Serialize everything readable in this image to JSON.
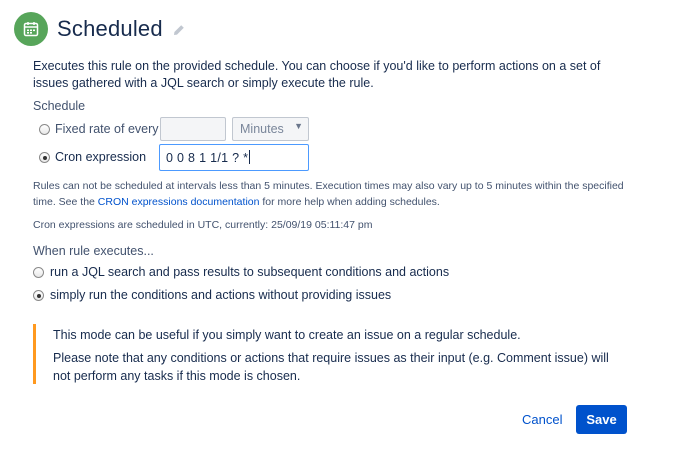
{
  "header": {
    "icon": "calendar-icon",
    "title": "Scheduled",
    "edit_icon": "pencil-icon"
  },
  "description": "Executes this rule on the provided schedule. You can choose if you'd like to perform actions on a set of issues gathered with a JQL search or simply execute the rule.",
  "schedule": {
    "label": "Schedule",
    "fixed_rate": {
      "label": "Fixed rate of every",
      "selected": false,
      "value": "",
      "unit": "Minutes"
    },
    "cron": {
      "label": "Cron expression",
      "selected": true,
      "value": "0 0 8 1 1/1 ? *"
    }
  },
  "help": {
    "text_before_link": "Rules can not be scheduled at intervals less than 5 minutes. Execution times may also vary up to 5 minutes within the specified time. See the ",
    "link_text": "CRON expressions documentation",
    "text_after_link": " for more help when adding schedules.",
    "utc_note": "Cron expressions are scheduled in UTC, currently: 25/09/19 05:11:47 pm"
  },
  "execution": {
    "label": "When rule executes...",
    "options": [
      {
        "label": "run a JQL search and pass results to subsequent conditions and actions",
        "selected": false
      },
      {
        "label": "simply run the conditions and actions without providing issues",
        "selected": true
      }
    ]
  },
  "info_panel": {
    "line1": "This mode can be useful if you simply want to create an issue on a regular schedule.",
    "line2": "Please note that any conditions or actions that require issues as their input (e.g. Comment issue) will not perform any tasks if this mode is chosen."
  },
  "footer": {
    "cancel_label": "Cancel",
    "save_label": "Save"
  },
  "colors": {
    "primary": "#0052cc",
    "trigger_green": "#57a55a",
    "warning_border": "#ff991f",
    "focus_border": "#4c9aff"
  }
}
